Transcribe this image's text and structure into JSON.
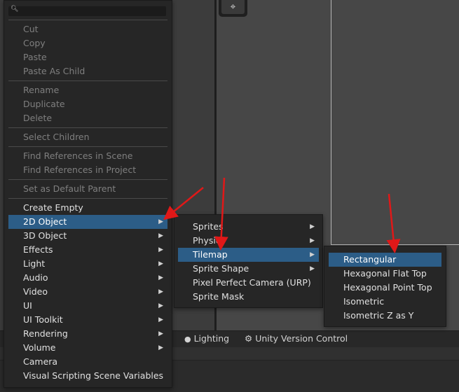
{
  "main_menu": {
    "search": {
      "placeholder": ""
    },
    "items": [
      {
        "label": "Cut",
        "enabled": false
      },
      {
        "label": "Copy",
        "enabled": false
      },
      {
        "label": "Paste",
        "enabled": false
      },
      {
        "label": "Paste As Child",
        "enabled": false
      },
      {
        "label": "Rename",
        "enabled": false
      },
      {
        "label": "Duplicate",
        "enabled": false
      },
      {
        "label": "Delete",
        "enabled": false
      },
      {
        "label": "Select Children",
        "enabled": false
      },
      {
        "label": "Find References in Scene",
        "enabled": false
      },
      {
        "label": "Find References in Project",
        "enabled": false
      },
      {
        "label": "Set as Default Parent",
        "enabled": false
      },
      {
        "label": "Create Empty",
        "enabled": true
      },
      {
        "label": "2D Object",
        "enabled": true,
        "submenu": true,
        "highlighted": true
      },
      {
        "label": "3D Object",
        "enabled": true,
        "submenu": true
      },
      {
        "label": "Effects",
        "enabled": true,
        "submenu": true
      },
      {
        "label": "Light",
        "enabled": true,
        "submenu": true
      },
      {
        "label": "Audio",
        "enabled": true,
        "submenu": true
      },
      {
        "label": "Video",
        "enabled": true,
        "submenu": true
      },
      {
        "label": "UI",
        "enabled": true,
        "submenu": true
      },
      {
        "label": "UI Toolkit",
        "enabled": true,
        "submenu": true
      },
      {
        "label": "Rendering",
        "enabled": true,
        "submenu": true
      },
      {
        "label": "Volume",
        "enabled": true,
        "submenu": true
      },
      {
        "label": "Camera",
        "enabled": true
      },
      {
        "label": "Visual Scripting Scene Variables",
        "enabled": true
      }
    ]
  },
  "object2d_menu": {
    "items": [
      {
        "label": "Sprites",
        "submenu": true
      },
      {
        "label": "Physics",
        "submenu": true
      },
      {
        "label": "Tilemap",
        "submenu": true,
        "highlighted": true
      },
      {
        "label": "Sprite Shape",
        "submenu": true
      },
      {
        "label": "Pixel Perfect Camera (URP)"
      },
      {
        "label": "Sprite Mask"
      }
    ]
  },
  "tilemap_menu": {
    "items": [
      {
        "label": "Rectangular",
        "highlighted": true
      },
      {
        "label": "Hexagonal Flat Top"
      },
      {
        "label": "Hexagonal Point Top"
      },
      {
        "label": "Isometric"
      },
      {
        "label": "Isometric Z as Y"
      }
    ]
  },
  "bottom_tabs": [
    {
      "label": "Lighting",
      "icon": "lightbulb-icon"
    },
    {
      "label": "Unity Version Control",
      "icon": "version-control-icon"
    }
  ],
  "colors": {
    "highlight": "#2c5d87",
    "annotation_arrow": "#e01818",
    "menu_bg": "#262626"
  }
}
